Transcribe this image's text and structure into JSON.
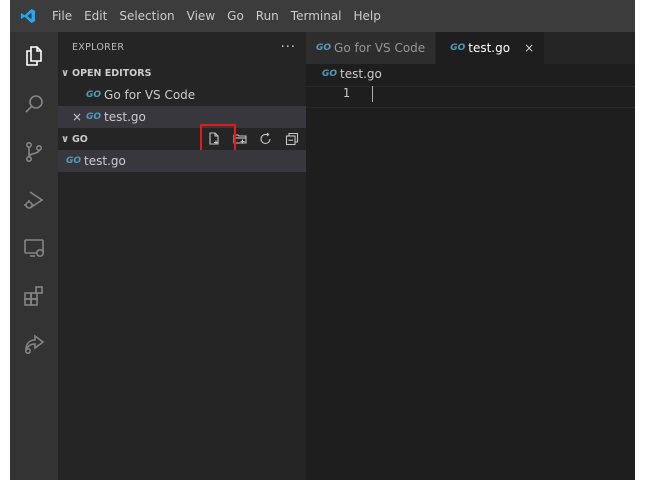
{
  "menu": [
    "File",
    "Edit",
    "Selection",
    "View",
    "Go",
    "Run",
    "Terminal",
    "Help"
  ],
  "sidebar": {
    "title": "EXPLORER",
    "more": "···",
    "open_editors": {
      "label": "OPEN EDITORS",
      "items": [
        {
          "badge": "GO",
          "label": "Go for VS Code",
          "close": ""
        },
        {
          "badge": "GO",
          "label": "test.go",
          "close": "×"
        }
      ]
    },
    "folder": {
      "label": "GO",
      "files": [
        {
          "badge": "GO",
          "label": "test.go"
        }
      ],
      "actions": [
        "new-file",
        "new-folder",
        "refresh",
        "collapse-all"
      ]
    }
  },
  "editor": {
    "tabs": [
      {
        "badge": "GO",
        "label": "Go for VS Code",
        "active": false,
        "close": ""
      },
      {
        "badge": "GO",
        "label": "test.go",
        "active": true,
        "close": "×"
      }
    ],
    "breadcrumb": {
      "badge": "GO",
      "label": "test.go"
    },
    "lines": [
      {
        "number": "1",
        "text": ""
      }
    ]
  },
  "colors": {
    "accent": "#007acc",
    "go_blue": "#519aba",
    "highlight": "#e01b1b"
  }
}
